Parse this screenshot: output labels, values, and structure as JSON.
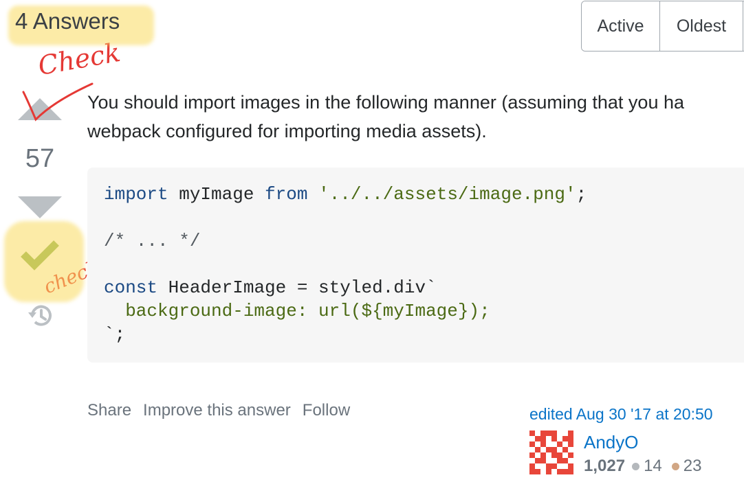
{
  "header": {
    "title": "4 Answers",
    "sort_tabs": [
      "Active",
      "Oldest"
    ]
  },
  "annotations": {
    "check_top": "Check",
    "check_bottom": "check"
  },
  "answer": {
    "vote_count": "57",
    "accepted": true,
    "body_lines": [
      "You should import images in the following manner (assuming that you ha",
      "webpack configured for importing media assets)."
    ],
    "code": {
      "line1_kw1": "import",
      "line1_name": " myImage ",
      "line1_kw2": "from",
      "line1_str": "'../../assets/image.png'",
      "line1_end": ";",
      "line2": "/* ... */",
      "line3_kw": "const",
      "line3_rest": " HeaderImage = styled.div`",
      "line4_str": "  background-image: url(${myImage});",
      "line5": "`;"
    },
    "actions": {
      "share": "Share",
      "improve": "Improve this answer",
      "follow": "Follow"
    },
    "edited": "edited Aug 30 '17 at 20:50",
    "user": {
      "name": "AndyO",
      "reputation": "1,027",
      "silver_badges": "14",
      "bronze_badges": "23"
    }
  },
  "colors": {
    "link": "#0a74c8",
    "accepted_green": "#8db154",
    "highlight": "#fada5e",
    "annotation_red": "#e53935",
    "vote_arrow": "#bbc0c4"
  }
}
